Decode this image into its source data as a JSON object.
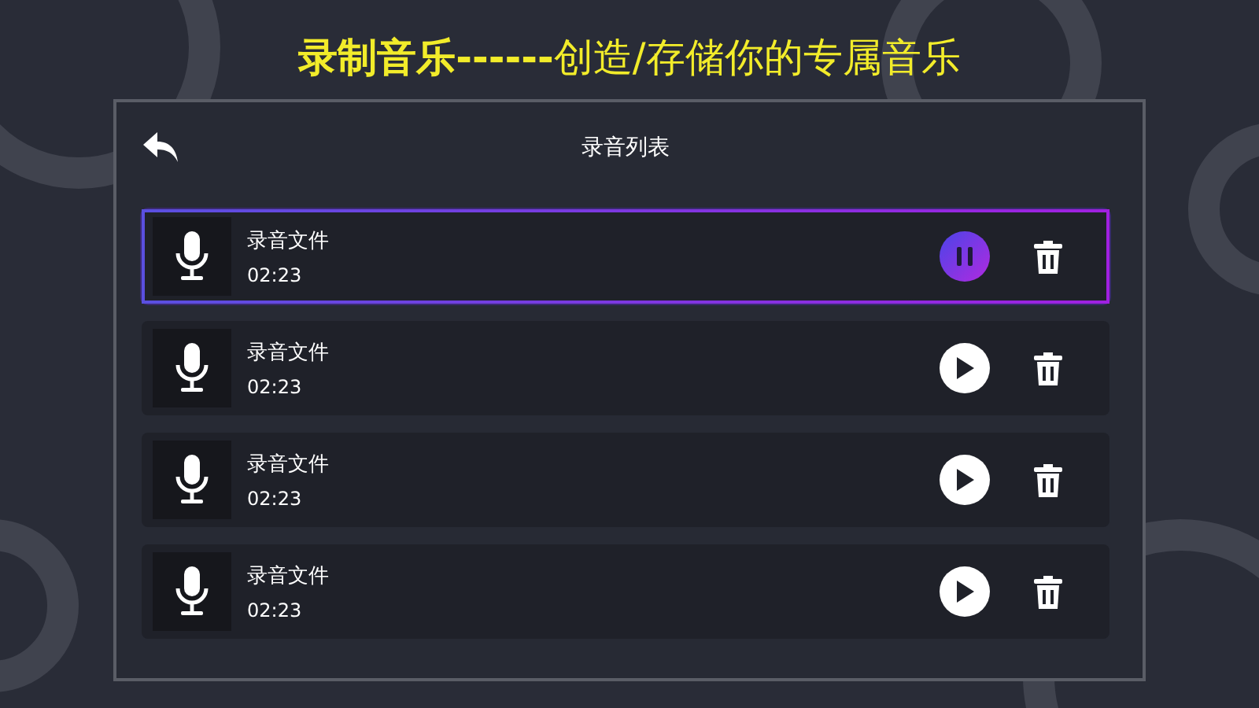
{
  "banner": {
    "text": "**录制音乐------**创造/存储你的专属音乐"
  },
  "panel": {
    "title": "录音列表"
  },
  "recordings": [
    {
      "name": "录音文件",
      "duration": "02:23",
      "selected": true,
      "playing": true
    },
    {
      "name": "录音文件",
      "duration": "02:23",
      "selected": false,
      "playing": false
    },
    {
      "name": "录音文件",
      "duration": "02:23",
      "selected": false,
      "playing": false
    },
    {
      "name": "录音文件",
      "duration": "02:23",
      "selected": false,
      "playing": false
    }
  ]
}
